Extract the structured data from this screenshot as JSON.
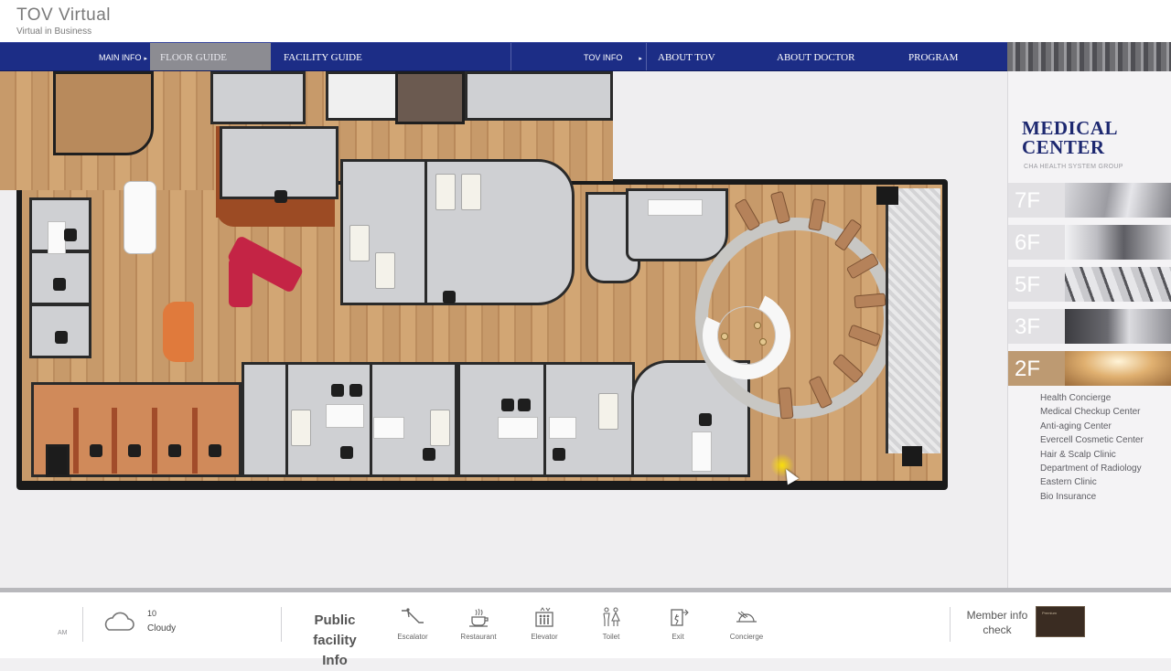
{
  "header": {
    "brand_title": "TOV  Virtual",
    "brand_subtitle": "Virtual in Business"
  },
  "nav": {
    "main_info": "MAIN INFO",
    "floor_guide": "FLOOR GUIDE",
    "facility_guide": "FACILITY GUIDE",
    "tov_info": "TOV INFO",
    "about_tov": "ABOUT TOV",
    "about_doctor": "ABOUT DOCTOR",
    "program": "PROGRAM",
    "arrow": "▸"
  },
  "sidebar": {
    "title": "MEDICAL CENTER",
    "title_line1": "MEDICAL",
    "title_line2": "CENTER",
    "subtitle": "CHA HEALTH SYSTEM GROUP",
    "floors": [
      {
        "label": "7F",
        "active": false
      },
      {
        "label": "6F",
        "active": false
      },
      {
        "label": "5F",
        "active": false
      },
      {
        "label": "3F",
        "active": false
      },
      {
        "label": "2F",
        "active": true
      }
    ],
    "departments": [
      "Health Concierge",
      "Medical Checkup Center",
      "Anti-aging Center",
      "Evercell Cosmetic Center",
      "Hair & Scalp Clinic",
      "Department of Radiology",
      "Eastern Clinic",
      "Bio Insurance"
    ]
  },
  "footer": {
    "time_period": "AM",
    "temperature": "10",
    "weather": "Cloudy",
    "public_facility_line1": "Public facility",
    "public_facility_line2": "Info",
    "facilities": [
      "Escalator",
      "Restaurant",
      "Elevator",
      "Toilet",
      "Exit",
      "Concierge"
    ],
    "member_line1": "Member info",
    "member_line2": "check",
    "member_card_text": "Premium"
  },
  "colors": {
    "nav_bg": "#1c2d86",
    "nav_active": "#8c8c92",
    "brand_navy": "#1d2870",
    "active_floor": "#bd9a72"
  }
}
